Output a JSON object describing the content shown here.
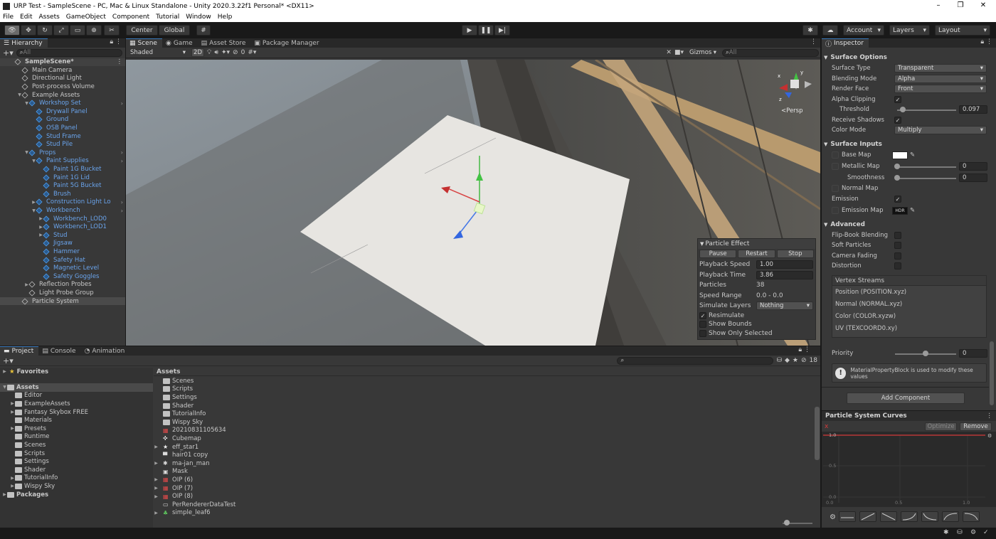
{
  "window": {
    "title": "URP Test - SampleScene - PC, Mac & Linux Standalone - Unity 2020.3.22f1 Personal* <DX11>",
    "minimize": "–",
    "maximize": "❐",
    "close": "✕"
  },
  "menu": [
    "File",
    "Edit",
    "Assets",
    "GameObject",
    "Component",
    "Tutorial",
    "Window",
    "Help"
  ],
  "toolbar": {
    "center": "Center",
    "global": "Global",
    "account": "Account",
    "layers": "Layers",
    "layout": "Layout"
  },
  "hierarchy": {
    "tab": "Hierarchy",
    "search_placeholder": "All",
    "items": [
      {
        "label": "SampleScene*",
        "depth": 0,
        "kind": "scene"
      },
      {
        "label": "Main Camera",
        "depth": 1,
        "kind": "go"
      },
      {
        "label": "Directional Light",
        "depth": 1,
        "kind": "go"
      },
      {
        "label": "Post-process Volume",
        "depth": 1,
        "kind": "go"
      },
      {
        "label": "Example Assets",
        "depth": 1,
        "kind": "go",
        "expanded": true
      },
      {
        "label": "Workshop Set",
        "depth": 2,
        "kind": "prefab",
        "expanded": true
      },
      {
        "label": "Drywall Panel",
        "depth": 3,
        "kind": "prefab"
      },
      {
        "label": "Ground",
        "depth": 3,
        "kind": "prefab"
      },
      {
        "label": "OSB Panel",
        "depth": 3,
        "kind": "prefab"
      },
      {
        "label": "Stud Frame",
        "depth": 3,
        "kind": "prefab"
      },
      {
        "label": "Stud Pile",
        "depth": 3,
        "kind": "prefab"
      },
      {
        "label": "Props",
        "depth": 2,
        "kind": "prefab",
        "expanded": true
      },
      {
        "label": "Paint Supplies",
        "depth": 3,
        "kind": "prefab",
        "expanded": true
      },
      {
        "label": "Paint 1G Bucket",
        "depth": 4,
        "kind": "prefab"
      },
      {
        "label": "Paint 1G Lid",
        "depth": 4,
        "kind": "prefab"
      },
      {
        "label": "Paint 5G Bucket",
        "depth": 4,
        "kind": "prefab"
      },
      {
        "label": "Brush",
        "depth": 4,
        "kind": "prefab"
      },
      {
        "label": "Construction Light Lo",
        "depth": 3,
        "kind": "prefab",
        "collapsed": true
      },
      {
        "label": "Workbench",
        "depth": 3,
        "kind": "prefab",
        "expanded": true
      },
      {
        "label": "Workbench_LOD0",
        "depth": 4,
        "kind": "prefab",
        "collapsed": true
      },
      {
        "label": "Workbench_LOD1",
        "depth": 4,
        "kind": "prefab",
        "collapsed": true
      },
      {
        "label": "Stud",
        "depth": 4,
        "kind": "prefab",
        "collapsed": true
      },
      {
        "label": "Jigsaw",
        "depth": 4,
        "kind": "prefab"
      },
      {
        "label": "Hammer",
        "depth": 4,
        "kind": "prefab"
      },
      {
        "label": "Safety Hat",
        "depth": 4,
        "kind": "prefab"
      },
      {
        "label": "Magnetic Level",
        "depth": 4,
        "kind": "prefab"
      },
      {
        "label": "Safety Goggles",
        "depth": 4,
        "kind": "prefab"
      },
      {
        "label": "Reflection Probes",
        "depth": 2,
        "kind": "go",
        "collapsed": true
      },
      {
        "label": "Light Probe Group",
        "depth": 2,
        "kind": "go"
      },
      {
        "label": "Particle System",
        "depth": 1,
        "kind": "go",
        "selected": true
      }
    ]
  },
  "scene_tabs": [
    {
      "label": "Scene",
      "active": true
    },
    {
      "label": "Game"
    },
    {
      "label": "Asset Store"
    },
    {
      "label": "Package Manager"
    }
  ],
  "scene_toolbar": {
    "shading": "Shaded",
    "mode2d": "2D",
    "hidden_count": "0",
    "gizmos": "Gizmos",
    "search_placeholder": "All",
    "persp": "Persp"
  },
  "particle_effect": {
    "title": "Particle Effect",
    "pause": "Pause",
    "restart": "Restart",
    "stop": "Stop",
    "rows": [
      {
        "label": "Playback Speed",
        "value": "1.00",
        "type": "field"
      },
      {
        "label": "Playback Time",
        "value": "3.86",
        "type": "field"
      },
      {
        "label": "Particles",
        "value": "38",
        "type": "text"
      },
      {
        "label": "Speed Range",
        "value": "0.0 - 0.0",
        "type": "text"
      },
      {
        "label": "Simulate Layers",
        "value": "Nothing",
        "type": "dropdown"
      }
    ],
    "checks": [
      {
        "label": "Resimulate",
        "checked": true
      },
      {
        "label": "Show Bounds",
        "checked": false
      },
      {
        "label": "Show Only Selected",
        "checked": false
      }
    ]
  },
  "inspector": {
    "tab": "Inspector",
    "surface_options": {
      "title": "Surface Options",
      "surface_type_label": "Surface Type",
      "surface_type": "Transparent",
      "blending_label": "Blending Mode",
      "blending": "Alpha",
      "render_face_label": "Render Face",
      "render_face": "Front",
      "alpha_clip_label": "Alpha Clipping",
      "threshold_label": "Threshold",
      "threshold": "0.097",
      "threshold_frac": 0.097,
      "receive_shadows_label": "Receive Shadows",
      "color_mode_label": "Color Mode",
      "color_mode": "Multiply"
    },
    "surface_inputs": {
      "title": "Surface Inputs",
      "base_map": "Base Map",
      "metallic_map": "Metallic Map",
      "metallic": "0",
      "smoothness_label": "Smoothness",
      "smoothness": "0",
      "normal_map": "Normal Map",
      "emission_label": "Emission",
      "emission_map": "Emission Map",
      "hdr": "HDR"
    },
    "advanced": {
      "title": "Advanced",
      "flipbook": "Flip-Book Blending",
      "soft_particles": "Soft Particles",
      "camera_fading": "Camera Fading",
      "distortion": "Distortion",
      "vertex_streams_title": "Vertex Streams",
      "streams": [
        "Position (POSITION.xyz)",
        "Normal (NORMAL.xyz)",
        "Color (COLOR.xyzw)",
        "UV (TEXCOORD0.xy)"
      ],
      "priority_label": "Priority",
      "priority": "0",
      "priority_frac": 0.5,
      "info": "MaterialPropertyBlock is used to modify these values"
    },
    "add_component": "Add Component"
  },
  "curves": {
    "title": "Particle System Curves",
    "optimize": "Optimize",
    "remove": "Remove",
    "y_labels": [
      "1.0",
      "0.5",
      "0.0"
    ],
    "x_labels": [
      "0.0",
      "0.5",
      "1.0"
    ]
  },
  "project": {
    "tabs": [
      {
        "label": "Project",
        "active": true
      },
      {
        "label": "Console"
      },
      {
        "label": "Animation"
      }
    ],
    "hidden_count": "18",
    "favorites": "Favorites",
    "tree": [
      {
        "label": "Assets",
        "depth": 0,
        "bold": true,
        "selected": true
      },
      {
        "label": "Editor",
        "depth": 1
      },
      {
        "label": "ExampleAssets",
        "depth": 1,
        "arrow": true
      },
      {
        "label": "Fantasy Skybox FREE",
        "depth": 1,
        "arrow": true
      },
      {
        "label": "Materials",
        "depth": 1
      },
      {
        "label": "Presets",
        "depth": 1,
        "arrow": true
      },
      {
        "label": "Runtime",
        "depth": 1
      },
      {
        "label": "Scenes",
        "depth": 1
      },
      {
        "label": "Scripts",
        "depth": 1
      },
      {
        "label": "Settings",
        "depth": 1
      },
      {
        "label": "Shader",
        "depth": 1
      },
      {
        "label": "TutorialInfo",
        "depth": 1,
        "arrow": true
      },
      {
        "label": "Wispy Sky",
        "depth": 1,
        "arrow": true
      },
      {
        "label": "Packages",
        "depth": 0,
        "bold": true,
        "arrow": true
      }
    ],
    "assets_header": "Assets",
    "assets": [
      {
        "label": "Scenes",
        "icon": "folder"
      },
      {
        "label": "Scripts",
        "icon": "folder"
      },
      {
        "label": "Settings",
        "icon": "folder"
      },
      {
        "label": "Shader",
        "icon": "folder"
      },
      {
        "label": "TutorialInfo",
        "icon": "folder"
      },
      {
        "label": "Wispy Sky",
        "icon": "folder"
      },
      {
        "label": "20210831105634",
        "icon": "image"
      },
      {
        "label": "Cubemap",
        "icon": "cubemap"
      },
      {
        "label": "eff_star1",
        "icon": "star",
        "arrow": true
      },
      {
        "label": "hair01 copy",
        "icon": "texture"
      },
      {
        "label": "ma-jan_man",
        "icon": "asterisk",
        "arrow": true
      },
      {
        "label": "Mask",
        "icon": "mask"
      },
      {
        "label": "OIP (6)",
        "icon": "image",
        "arrow": true
      },
      {
        "label": "OIP (7)",
        "icon": "image",
        "arrow": true
      },
      {
        "label": "OIP (8)",
        "icon": "image",
        "arrow": true
      },
      {
        "label": "PerRendererDataTest",
        "icon": "material"
      },
      {
        "label": "simple_leaf6",
        "icon": "leaf",
        "arrow": true
      }
    ]
  },
  "colors": {
    "accent": "#3a79bb",
    "selection": "#2c5d87",
    "prefab": "#6aa4ec",
    "curve": "#d33b3b"
  }
}
